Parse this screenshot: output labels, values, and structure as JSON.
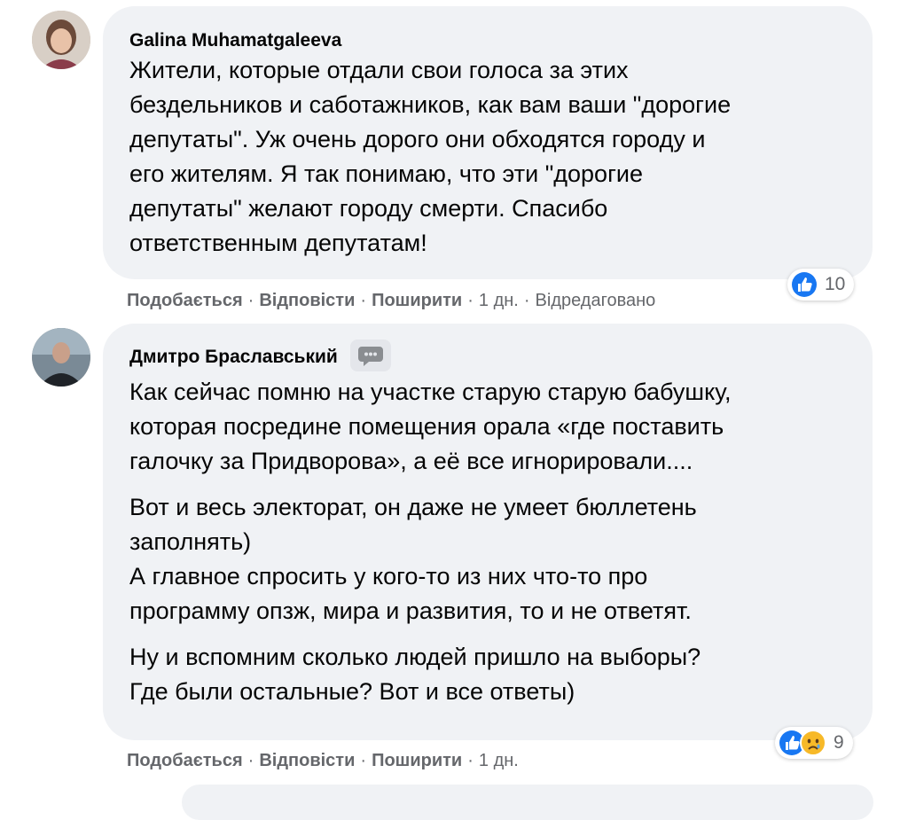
{
  "comments": [
    {
      "author": "Galina Muhamatgaleeva",
      "lines": [
        "Жители, которые отдали свои голоса за этих",
        "бездельников и саботажников, как вам ваши \"дорогие",
        "депутаты\". Уж очень дорого они обходятся городу и",
        "его жителям. Я так понимаю, что эти \"дорогие",
        "депутаты\" желают городу смерти. Спасибо",
        "ответственным депутатам!"
      ],
      "actions": {
        "like": "Подобається",
        "reply": "Відповісти",
        "share": "Поширити",
        "time": "1 дн.",
        "edited": "Відредаговано"
      },
      "reactions": {
        "icons": [
          "like-icon"
        ],
        "count": "10"
      },
      "avatar_color": "#b89a86"
    },
    {
      "author": "Дмитро Браславський",
      "badge_icon": "top-fan-badge-icon",
      "paragraphs": [
        [
          "Как сейчас помню на участке старую старую бабушку,",
          "которая посредине помещения орала «где поставить",
          "галочку за Придворова», а её все игнорировали...."
        ],
        [
          "Вот и весь электорат, он даже не умеет бюллетень",
          "заполнять)",
          "А главное спросить у кого-то из них что-то про",
          "программу опзж, мира и развития, то и не ответят."
        ],
        [
          "Ну и вспомним сколько людей пришло на выборы?",
          "Где были остальные? Вот и все ответы)"
        ]
      ],
      "actions": {
        "like": "Подобається",
        "reply": "Відповісти",
        "share": "Поширити",
        "time": "1 дн."
      },
      "reactions": {
        "icons": [
          "like-icon",
          "sad-icon"
        ],
        "count": "9"
      },
      "avatar_color": "#3a4450"
    }
  ],
  "colors": {
    "bubble": "#f0f2f5",
    "meta_text": "#65676b",
    "like_blue": "#1877f2",
    "sad_yellow": "#f7b928"
  }
}
